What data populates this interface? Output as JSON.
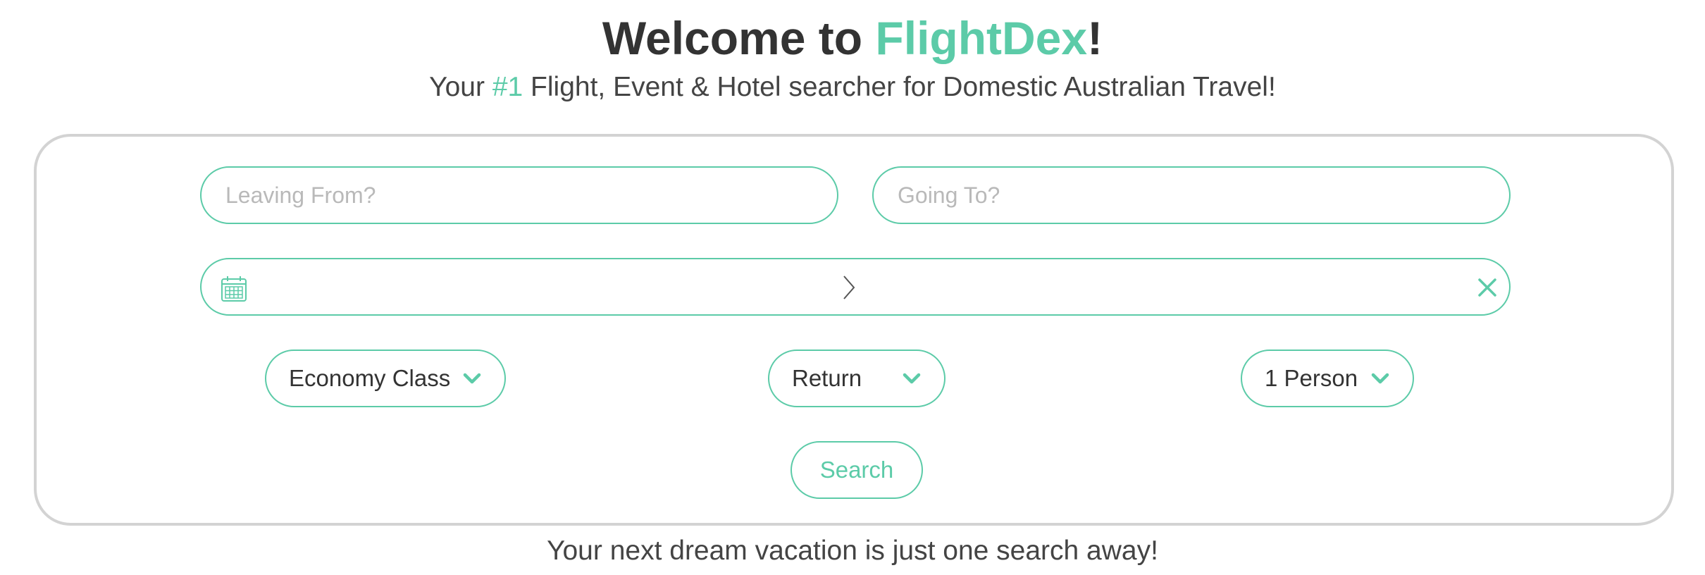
{
  "header": {
    "title_prefix": "Welcome to ",
    "title_brand": "FlightDex",
    "title_suffix": "!",
    "subtitle_prefix": "Your ",
    "subtitle_rank": "#1",
    "subtitle_rest": " Flight, Event & Hotel searcher for Domestic Australian Travel!"
  },
  "form": {
    "leaving_from_placeholder": "Leaving From?",
    "going_to_placeholder": "Going To?",
    "date_range_icon": "calendar-icon",
    "date_range_separator_icon": "chevron-right-icon",
    "date_range_clear_icon": "close-icon",
    "class_select": "Economy Class",
    "trip_type_select": "Return",
    "passengers_select": "1 Person",
    "select_icon": "chevron-down-icon",
    "search_label": "Search"
  },
  "footer": {
    "tagline": "Your next dream vacation is just one search away!"
  },
  "colors": {
    "accent": "#5ccba8",
    "text": "#333333",
    "card_border": "#d3d3d3",
    "placeholder": "#b9b9b9"
  }
}
